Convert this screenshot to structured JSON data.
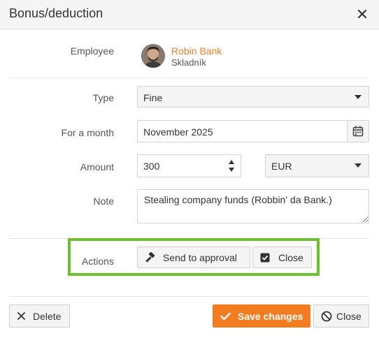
{
  "dialog": {
    "title": "Bonus/deduction"
  },
  "employee": {
    "label": "Employee",
    "name": "Robin Bank",
    "role": "Skladník"
  },
  "type": {
    "label": "Type",
    "value": "Fine"
  },
  "month": {
    "label": "For a month",
    "value": "November 2025"
  },
  "amount": {
    "label": "Amount",
    "value": "300",
    "currency": "EUR"
  },
  "note": {
    "label": "Note",
    "value": "Stealing company funds (Robbin' da Bank.)"
  },
  "actions": {
    "label": "Actions",
    "send_label": "Send to approval",
    "close_label": "Close"
  },
  "footer": {
    "delete_label": "Delete",
    "save_label": "Save changes",
    "close_label": "Close"
  },
  "colors": {
    "accent": "#f47c20",
    "highlight": "#6cc22e",
    "employee_name": "#e8822a"
  },
  "icons": {
    "close": "close-icon",
    "calendar": "calendar-icon",
    "gavel": "gavel-icon",
    "checkbox": "checkbox-icon",
    "delete": "x-icon",
    "save": "check-icon",
    "footer_close": "ban-icon"
  }
}
